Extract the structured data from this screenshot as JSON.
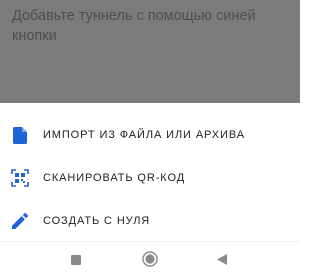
{
  "background": {
    "empty_hint": "Добавьте туннель с помощью синей кнопки"
  },
  "sheet": {
    "items": [
      {
        "label": "ИМПОРТ ИЗ ФАЙЛА ИЛИ АРХИВА",
        "icon": "file-icon"
      },
      {
        "label": "СКАНИРОВАТЬ QR-КОД",
        "icon": "qr-code-icon"
      },
      {
        "label": "СОЗДАТЬ С НУЛЯ",
        "icon": "pencil-icon"
      }
    ]
  },
  "navbar": {
    "buttons": [
      "recents-icon",
      "home-icon",
      "back-icon"
    ]
  },
  "colors": {
    "accent": "#1e64d4",
    "scrim": "#7b7b7b",
    "text": "#1f1f1f",
    "nav_icon": "#8a8a8a"
  }
}
